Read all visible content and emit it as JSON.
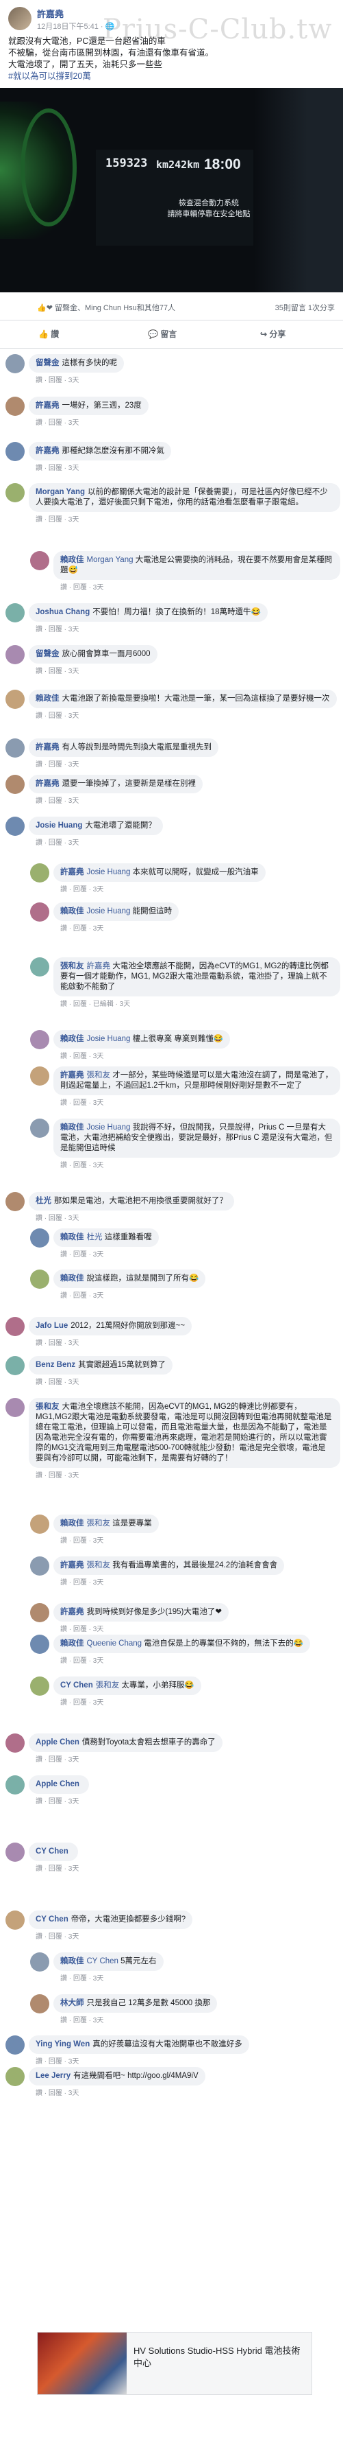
{
  "post": {
    "author": "許嘉堯",
    "meta": "12月18日下午5:41 · 🌐",
    "watermark": "Prius-C-Club.tw",
    "lines": [
      "就跟沒有大電池，PC還是一台超省油的車",
      "不被騙，從台南市區開到林園，有油還有像車有省道。",
      "大電池壞了，開了五天，油耗只多一些些",
      "#就以為可以撐到20萬"
    ],
    "photo": {
      "odometer": "159323",
      "odometer_unit": "km",
      "trip": "242",
      "trip_unit": "km",
      "clock": "18:00",
      "warning_lines": [
        "檢查混合動力系統",
        "請將車輛停靠在安全地點"
      ]
    }
  },
  "reactions": {
    "names": "👍❤ 留聲金、Ming Chun Hsu和其他77人",
    "counts": "35則留言 1次分享"
  },
  "actions": {
    "like": "讚",
    "comment": "留言",
    "share": "分享"
  },
  "comments": [
    {
      "name": "留聲金",
      "text": "這樣有多快的呢",
      "meta": "讚 · 回覆 · 3天"
    },
    {
      "name": "許嘉堯",
      "text": "一場好，第三週，23度",
      "meta": "讚 · 回覆 · 3天"
    },
    {
      "name": "許嘉堯",
      "text": "那種紀錄怎麼沒有那不開冷氣",
      "meta": "讚 · 回覆 · 3天"
    },
    {
      "name": "Morgan Yang",
      "text": "以前的都關係大電池的設計是「保養需要」，可是社區內好像已經不少人要換大電池了，還好後面只剩下電池，你用的話電池看怎麼看車子跟電組。",
      "meta": "讚 · 回覆 · 3天"
    },
    {
      "name": "賴政佳",
      "mention": "Morgan Yang",
      "text": "大電池是公需要換的消耗品，現在要不然要用會是某種問題😅",
      "meta": "讚 · 回覆 · 3天"
    },
    {
      "name": "Joshua Chang",
      "text": "不要怕！周力福！換了在換新的！18萬時還牛😂",
      "meta": "讚 · 回覆 · 3天"
    },
    {
      "name": "留聲金",
      "text": "放心開會算車一面月6000",
      "meta": "讚 · 回覆 · 3天"
    },
    {
      "name": "賴政佳",
      "text": "大電池跟了新換電是要換啦！大電池是一筆，某一回為這樣換了是要好機一次",
      "meta": "讚 · 回覆 · 3天"
    },
    {
      "name": "許嘉堯",
      "text": "有人等說到是時間先到換大電瓶是重視先到",
      "meta": "讚 · 回覆 · 3天"
    },
    {
      "name": "許嘉堯",
      "text": "還要一筆換掉了，這要新是是樣在別裡",
      "meta": "讚 · 回覆 · 3天"
    },
    {
      "name": "Josie Huang",
      "text": "大電池壞了還能開？",
      "meta": "讚 · 回覆 · 3天"
    },
    {
      "name": "許嘉堯",
      "mention": "Josie Huang",
      "text": "本來就可以開呀，就變成一般汽油車",
      "meta": "讚 · 回覆 · 3天"
    },
    {
      "name": "賴政佳",
      "mention": "Josie Huang",
      "text": "能開但這時",
      "meta": "讚 · 回覆 · 3天"
    },
    {
      "name": "張和友",
      "mention": "許嘉堯",
      "text": "大電池全壞應該不能開，因為eCVT的MG1, MG2的轉速比例都要有一個才能動作，MG1, MG2跟大電池是電動系統，電池掛了，理論上就不能啟動不能動了",
      "meta": "讚 · 回覆 · 已編輯 · 3天"
    },
    {
      "name": "賴政佳",
      "mention": "Josie Huang",
      "text": "樓上很專業 專業到難懂😂",
      "meta": "讚 · 回覆 · 3天"
    },
    {
      "name": "許嘉堯",
      "mention": "張和友",
      "text": "才一部分，某些時候還是可以是大電池沒在調了，問是電池了，剛過起電量上，不過回起1.2千km，只是那時候剛好剛好是數不一定了",
      "meta": "讚 · 回覆 · 3天"
    },
    {
      "name": "賴政佳",
      "mention": "Josie Huang",
      "text": "我說得不好，但說開我，只是說得，Prius C 一旦是有大電池，大電池把補給安全便搬出，要說是最好，那Prius C 還是沒有大電池，但是能開但這時候",
      "meta": "讚 · 回覆 · 3天"
    },
    {
      "name": "杜光",
      "text": "那如果是電池，大電池把不用換很重要開就好了？",
      "meta": "讚 · 回覆 · 3天"
    },
    {
      "name": "賴政佳",
      "mention": "杜光",
      "text": "這樣重難看喔",
      "meta": "讚 · 回覆 · 3天"
    },
    {
      "name": "賴政佳",
      "text": "說這樣跑，這就是開到了所有😂",
      "meta": "讚 · 回覆 · 3天"
    },
    {
      "name": "Jafo Lue",
      "text": "2012，21萬隔好你開放到那邊~~",
      "meta": "讚 · 回覆 · 3天"
    },
    {
      "name": "Benz Benz",
      "text": "其實跟超過15萬就到算了",
      "meta": "讚 · 回覆 · 3天"
    },
    {
      "name": "張和友",
      "text": "大電池全壞應該不能開，因為eCVT的MG1, MG2的轉速比例都要有，MG1,MG2跟大電池是電動系統要發電，電池是可以開沒回轉到但電池再開就整電池是總在電工電池，但理論上可以發電，而且電池電量大量，也是因為不能動了，電池是因為電池完全沒有電的，你需要電池再來處理，電池若是開始進行的，所以以電池實際的MG1交流電用到三角電壓電池500-700轉就能少發動！電池是完全很壞，電池是要與有冷卻可以開，可能電池剩下，是需要有好轉的了！",
      "meta": "讚 · 回覆 · 3天"
    },
    {
      "name": "賴政佳",
      "mention": "張和友",
      "text": "這是要專業",
      "meta": "讚 · 回覆 · 3天"
    },
    {
      "name": "許嘉堯",
      "mention": "張和友",
      "text": "我有看過專業書的，其最後是24.2的油耗會會會",
      "meta": "讚 · 回覆 · 3天"
    },
    {
      "name": "許嘉堯",
      "text": "我到時候到好像是多少(195)大電池了❤",
      "meta": "讚 · 回覆 · 3天"
    },
    {
      "name": "賴政佳",
      "mention": "Queenie Chang",
      "text": "電池自保是上的專業但不夠的，無法下去的😂",
      "meta": "讚 · 回覆 · 3天"
    },
    {
      "name": "CY Chen",
      "mention": "張和友",
      "text": "太專業，小弟拜服😂",
      "meta": "讚 · 回覆 · 3天"
    },
    {
      "name": "Apple Chen",
      "text": "債務對Toyota太會粗去想車子的壽命了",
      "meta": "讚 · 回覆 · 3天"
    },
    {
      "name": "Apple Chen",
      "text": "",
      "meta": "讚 · 回覆 · 3天"
    },
    {
      "name": "CY Chen",
      "text": "",
      "meta": "讚 · 回覆 · 3天"
    },
    {
      "name": "CY Chen",
      "text": "帝帝，大電池更換都要多少錢啊?",
      "meta": "讚 · 回覆 · 3天"
    },
    {
      "name": "賴政佳",
      "mention": "CY Chen",
      "text": "5萬元左右",
      "meta": "讚 · 回覆 · 3天"
    },
    {
      "name": "林大師",
      "text": "只是我自己 12萬多是數 45000 換那",
      "meta": "讚 · 回覆 · 3天"
    },
    {
      "name": "Ying Ying Wen",
      "text": "真的好羨幕這沒有大電池開車也不敢進好多",
      "meta": "讚 · 回覆 · 3天"
    },
    {
      "name": "Lee Jerry",
      "text": "有這幾間看吧~ http://goo.gl/4MA9iV",
      "meta": "讚 · 回覆 · 3天"
    }
  ],
  "link_card": {
    "title": "HV Solutions Studio-HSS Hybrid 電池技術中心"
  },
  "colors": {
    "link": "#385898",
    "bubble": "#f0f2f5",
    "like": "#2078f4",
    "love": "#f0284a"
  }
}
